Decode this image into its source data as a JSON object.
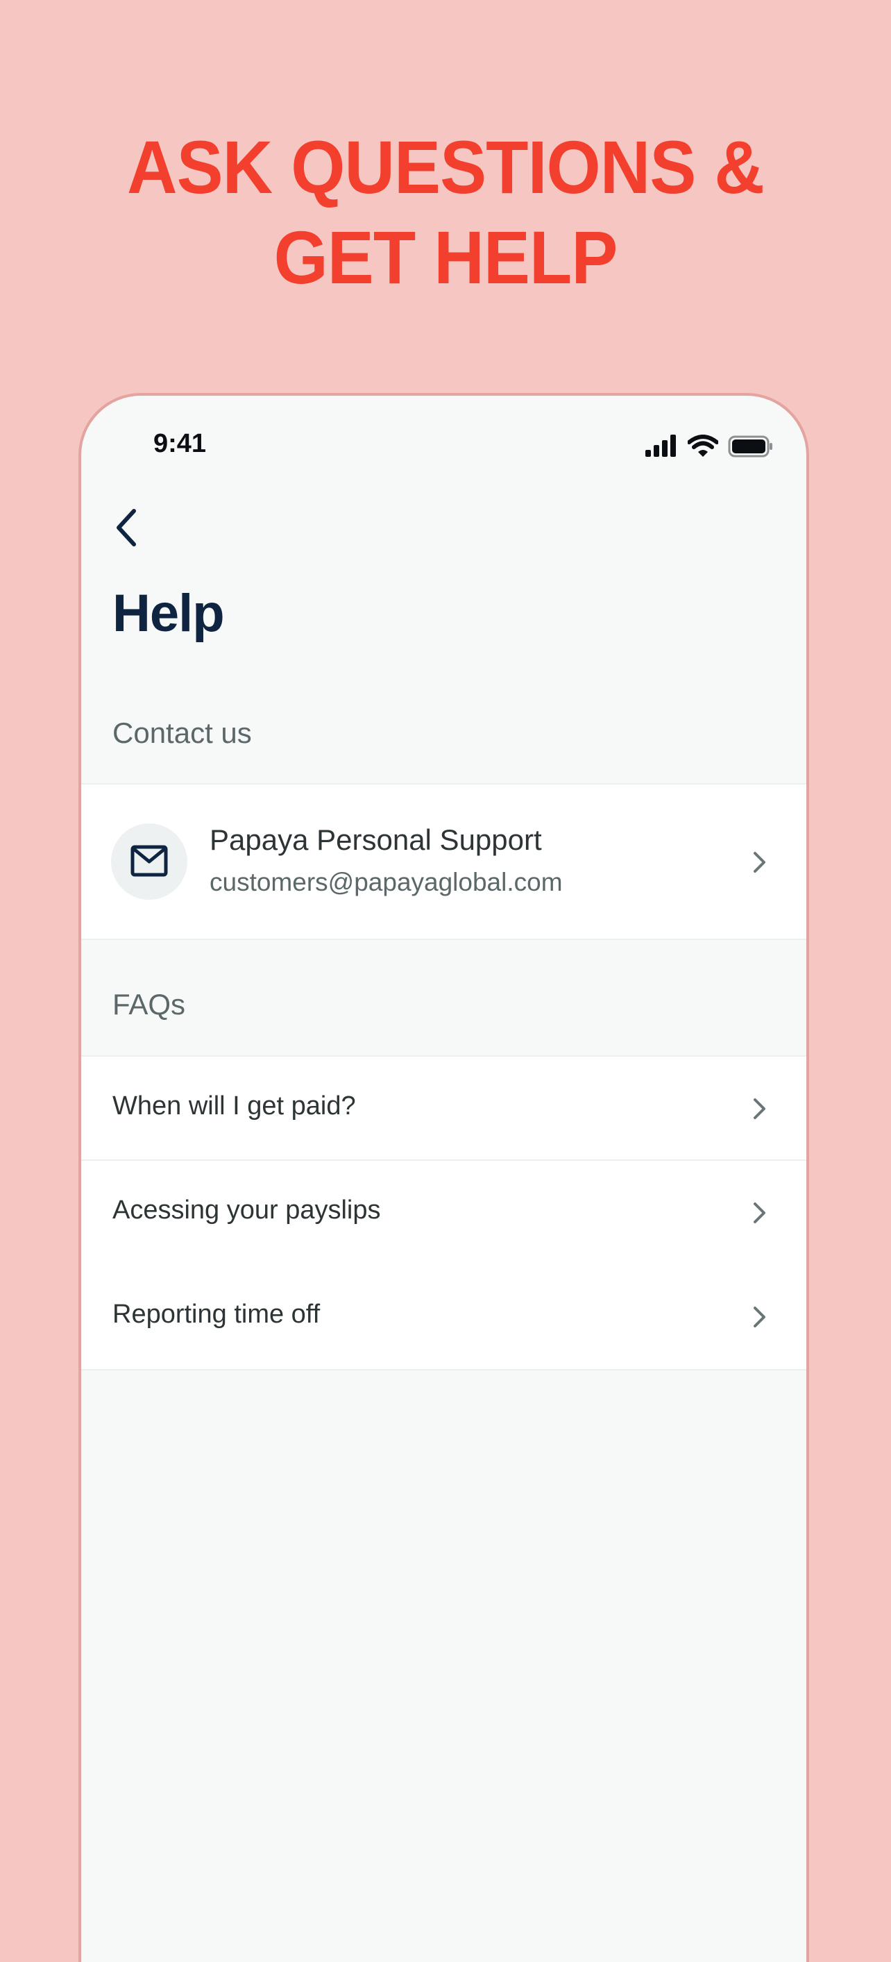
{
  "headline": {
    "line1": "ASK QUESTIONS &",
    "line2": "GET HELP"
  },
  "status_bar": {
    "time": "9:41",
    "icons": [
      "cellular-signal-icon",
      "wifi-icon",
      "battery-icon"
    ]
  },
  "nav": {
    "back_icon": "chevron-left-icon"
  },
  "page": {
    "title": "Help"
  },
  "contact": {
    "section_label": "Contact us",
    "name": "Papaya Personal Support",
    "email": "customers@papayaglobal.com",
    "icon": "mail-icon"
  },
  "faqs": {
    "section_label": "FAQs",
    "items": [
      {
        "label": "When will I get paid?"
      },
      {
        "label": "Acessing your payslips"
      },
      {
        "label": "Reporting time off"
      }
    ]
  },
  "colors": {
    "background": "#f6c7c2",
    "headline": "#f3402e",
    "title": "#0f2440",
    "phone_bg": "#f7f9f9"
  }
}
